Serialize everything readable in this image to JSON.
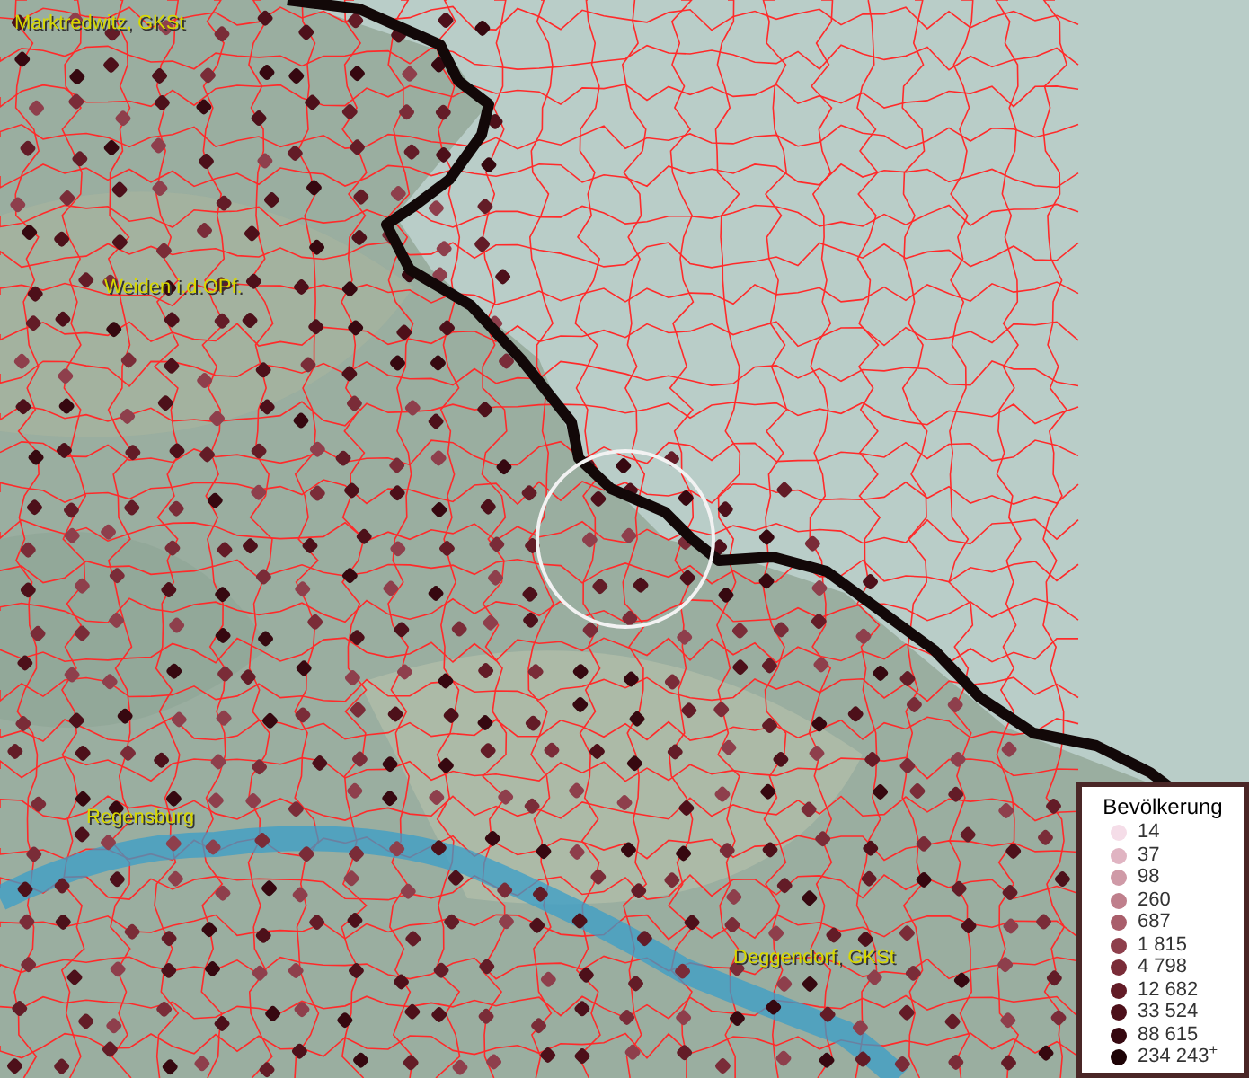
{
  "map": {
    "places": [
      {
        "name": "Marktredwitz, GKSt"
      },
      {
        "name": "Weiden i.d.OPf."
      },
      {
        "name": "Regensburg"
      },
      {
        "name": "Deggendorf, GKSt"
      }
    ]
  },
  "legend": {
    "title": "Bevölkerung",
    "items": [
      {
        "label": "14",
        "color": "#f5dde8"
      },
      {
        "label": "37",
        "color": "#e0b4c2"
      },
      {
        "label": "98",
        "color": "#cf9aa7"
      },
      {
        "label": "260",
        "color": "#bf7f8c"
      },
      {
        "label": "687",
        "color": "#a95e6b"
      },
      {
        "label": "1 815",
        "color": "#8e3f4c"
      },
      {
        "label": "4 798",
        "color": "#7a2c38"
      },
      {
        "label": "12 682",
        "color": "#631c27"
      },
      {
        "label": "33 524",
        "color": "#4d101a"
      },
      {
        "label": "88 615",
        "color": "#360810"
      },
      {
        "label": "234 243$^{+}$",
        "color": "#1e0306"
      }
    ]
  }
}
